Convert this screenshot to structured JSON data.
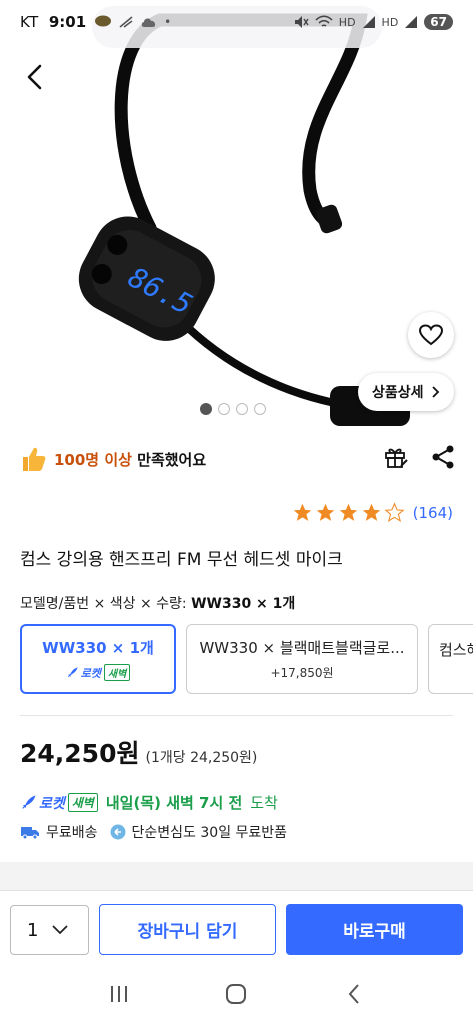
{
  "status_bar": {
    "carrier": "KT",
    "time": "9:01",
    "battery": "67"
  },
  "product": {
    "title": "컴스 강의용 핸즈프리 FM 무선 헤드셋 마이크",
    "display_reading": "86.5",
    "image_dots": {
      "total": 4,
      "active_index": 0
    }
  },
  "hero": {
    "detail_button_label": "상품상세"
  },
  "likes": {
    "count_text": "100명 이상",
    "suffix_text": " 만족했어요"
  },
  "rating": {
    "stars": 4,
    "max": 5,
    "review_count_text": "(164)"
  },
  "options": {
    "label_prefix": "모델명/품번 × 색상 × 수량: ",
    "selected_value": "WW330 × 1개",
    "items": [
      {
        "name": "WW330 × 1개",
        "badge": "로켓",
        "badge_tag": "새벽",
        "selected": true
      },
      {
        "name": "WW330 × 블랙매트블랙글로...",
        "sub": "+17,850원",
        "selected": false
      },
      {
        "name": "컴스헤",
        "selected": false
      }
    ]
  },
  "price": {
    "value": "24,250원",
    "unit_text": "(1개당 24,250원)"
  },
  "delivery": {
    "rocket_label": "로켓",
    "dawn_tag": "새벽",
    "date_text": "내일(목) 새벽 7시 전",
    "arrive_text": "도착",
    "free_shipping": "무료배송",
    "return_text": "단순변심도 30일 무료반품"
  },
  "bottom_bar": {
    "quantity": "1",
    "cart_label": "장바구니 담기",
    "buy_label": "바로구매"
  },
  "colors": {
    "accent_blue": "#346aff",
    "rocket_green": "#1a9e4a",
    "like_orange": "#c8500a",
    "star_orange": "#f08a24"
  },
  "icons": {
    "back": "back-arrow-icon",
    "heart": "heart-icon",
    "thumbs": "thumbs-up-icon",
    "gift": "gift-icon",
    "share": "share-icon",
    "truck": "truck-icon",
    "return": "return-icon"
  }
}
